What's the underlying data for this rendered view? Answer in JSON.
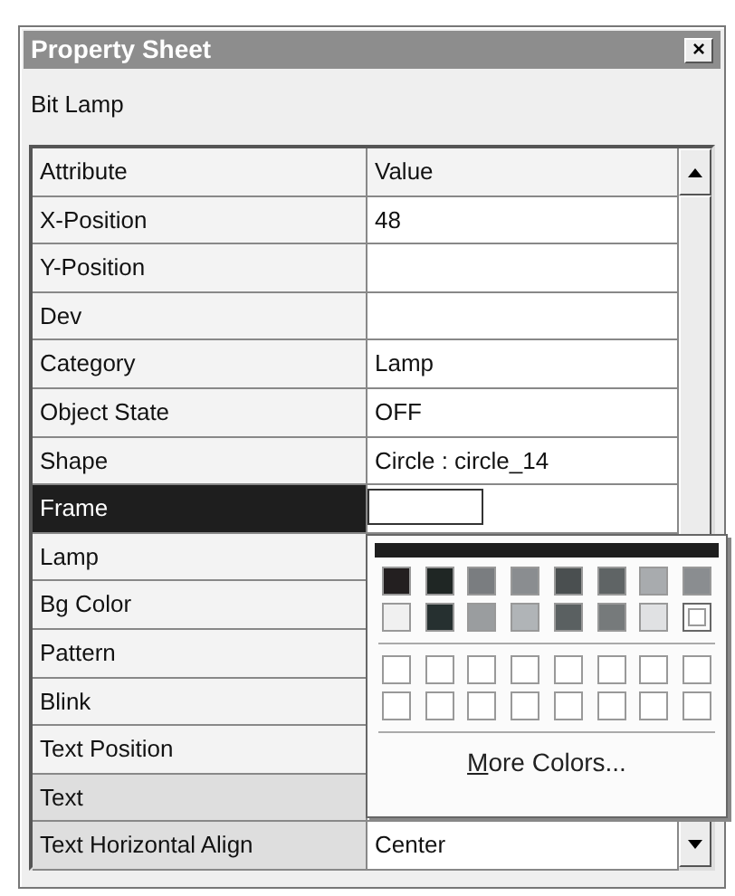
{
  "window": {
    "title": "Property Sheet",
    "close": "×"
  },
  "object_label": "Bit Lamp",
  "grid": {
    "columns": [
      "Attribute",
      "Value"
    ],
    "rows": [
      {
        "attribute": "X-Position",
        "kind": "text",
        "value": "48",
        "selected": false,
        "shaded": false
      },
      {
        "attribute": "Y-Position",
        "kind": "text",
        "selected": false,
        "shaded": false
      },
      {
        "attribute": "Dev",
        "kind": "text",
        "selected": false,
        "shaded": false
      },
      {
        "attribute": "Category",
        "kind": "text",
        "value": "Lamp",
        "selected": false,
        "shaded": false
      },
      {
        "attribute": "Object State",
        "kind": "text",
        "value": "OFF",
        "selected": false,
        "shaded": false
      },
      {
        "attribute": "Shape",
        "kind": "text",
        "value": "Circle : circle_14",
        "selected": false,
        "shaded": false
      },
      {
        "attribute": "Frame",
        "kind": "color",
        "color": "#ffffff",
        "selected": true,
        "shaded": false
      },
      {
        "attribute": "Lamp",
        "kind": "text",
        "selected": false,
        "shaded": false
      },
      {
        "attribute": "Bg Color",
        "kind": "text",
        "selected": false,
        "shaded": false
      },
      {
        "attribute": "Pattern",
        "kind": "text",
        "selected": false,
        "shaded": false
      },
      {
        "attribute": "Blink",
        "kind": "text",
        "selected": false,
        "shaded": false
      },
      {
        "attribute": "Text Position",
        "kind": "text",
        "selected": false,
        "shaded": false
      },
      {
        "attribute": "Text",
        "kind": "text",
        "selected": false,
        "shaded": true
      },
      {
        "attribute": "Text Horizontal Align",
        "kind": "text",
        "value": "Center",
        "selected": false,
        "shaded": true
      }
    ]
  },
  "color_popup": {
    "current_color_bar": {
      "color": "#1e1e1e"
    },
    "swatches": [
      {
        "color": "#231f20",
        "selected": false
      },
      {
        "color": "#1f2624",
        "selected": false
      },
      {
        "color": "#7a7d80",
        "selected": false
      },
      {
        "color": "#8a8d90",
        "selected": false
      },
      {
        "color": "#4a4f50",
        "selected": false
      },
      {
        "color": "#5f6465",
        "selected": false
      },
      {
        "color": "#a8abae",
        "selected": false
      },
      {
        "color": "#8a8d90",
        "selected": false
      },
      {
        "color": "#f0f0f0",
        "selected": false
      },
      {
        "color": "#263030",
        "selected": false
      },
      {
        "color": "#9a9d9f",
        "selected": false
      },
      {
        "color": "#b0b4b7",
        "selected": false
      },
      {
        "color": "#5a6061",
        "selected": false
      },
      {
        "color": "#767a7b",
        "selected": false
      },
      {
        "color": "#e0e1e3",
        "selected": false
      },
      {
        "color": "#ffffff",
        "selected": true
      }
    ],
    "custom_swatches": [
      {
        "color": "#ffffff"
      },
      {
        "color": "#ffffff"
      },
      {
        "color": "#ffffff"
      },
      {
        "color": "#ffffff"
      },
      {
        "color": "#ffffff"
      },
      {
        "color": "#ffffff"
      },
      {
        "color": "#ffffff"
      },
      {
        "color": "#ffffff"
      },
      {
        "color": "#ffffff"
      },
      {
        "color": "#ffffff"
      },
      {
        "color": "#ffffff"
      },
      {
        "color": "#ffffff"
      },
      {
        "color": "#ffffff"
      },
      {
        "color": "#ffffff"
      },
      {
        "color": "#ffffff"
      },
      {
        "color": "#ffffff"
      }
    ],
    "more_button": {
      "label": "More Colors...",
      "underline_first_letter": true
    }
  }
}
